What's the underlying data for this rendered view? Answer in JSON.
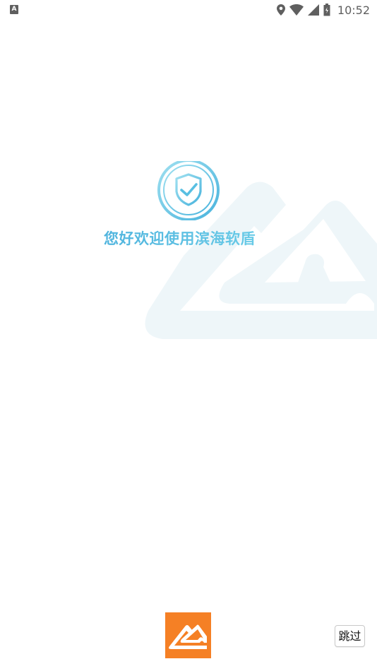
{
  "status_bar": {
    "notification_icon_letter": "A",
    "time": "10:52",
    "icons": [
      "notification-icon",
      "location-icon",
      "wifi-icon",
      "signal-icon",
      "battery-icon"
    ]
  },
  "welcome": {
    "text": "您好欢迎使用滨海软盾",
    "logo_icon": "shield-check-icon",
    "colors": {
      "text_start": "#4fb4de",
      "text_end": "#6ccde8",
      "watermark": "#eef7fa"
    }
  },
  "footer": {
    "brand_color": "#f58025",
    "brand_icon": "brand-logo-icon",
    "skip_label": "跳过"
  }
}
